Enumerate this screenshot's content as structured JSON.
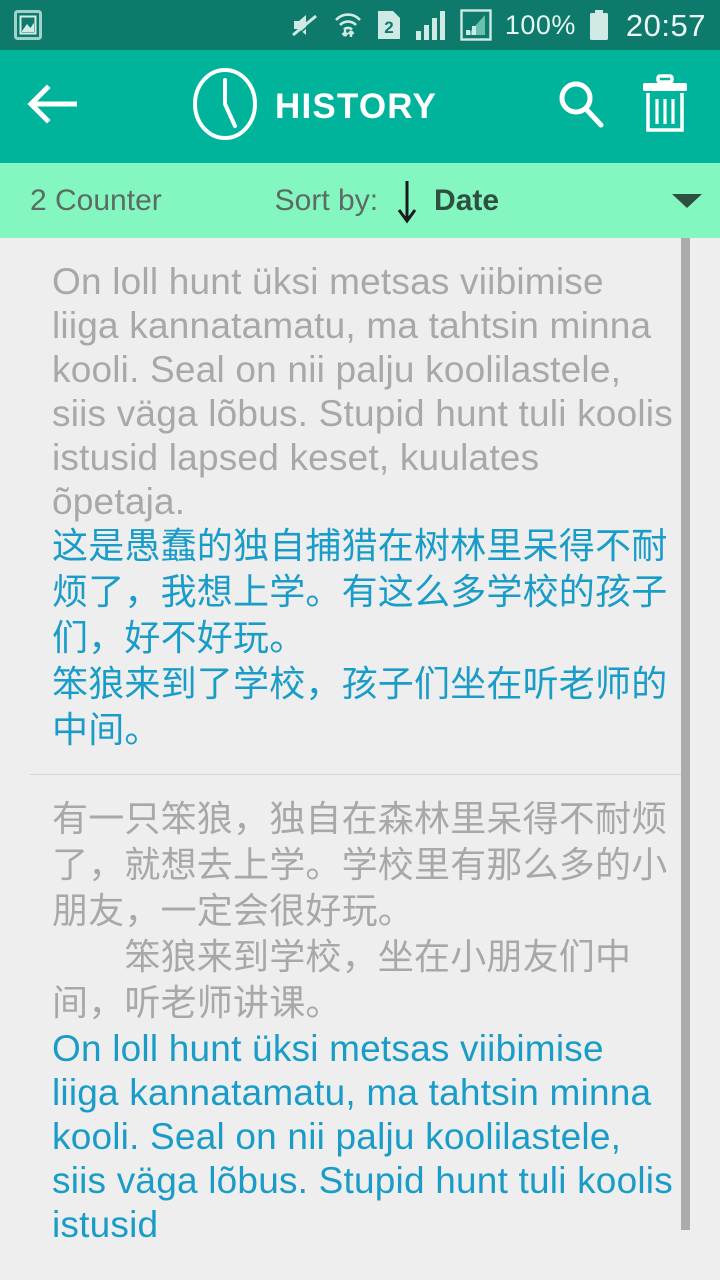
{
  "status_bar": {
    "icons": [
      "image-notification-icon",
      "mute-icon",
      "wifi-transfer-icon",
      "sim2-icon",
      "signal-bars-icon",
      "signal-box-icon"
    ],
    "battery_percent": "100%",
    "battery_icon": "battery-full-icon",
    "clock": "20:57",
    "background_color": "#0d7a6b"
  },
  "action_bar": {
    "back_icon": "arrow-left-icon",
    "clock_icon": "clock-icon",
    "title": "HISTORY",
    "search_icon": "search-icon",
    "delete_icon": "trash-icon",
    "background_color": "#00b49c",
    "text_color": "#ffffff"
  },
  "sort_bar": {
    "counter": "2 Counter",
    "sort_label": "Sort by:",
    "sort_direction_icon": "arrow-down-icon",
    "sort_value": "Date",
    "dropdown_icon": "chevron-down-icon",
    "background_color": "#84f6bf"
  },
  "history": {
    "items": [
      {
        "source_text": "On loll hunt üksi metsas viibimise liiga kannatamatu, ma tahtsin minna kooli. Seal on nii palju koolilastele, siis väga lõbus. Stupid hunt tuli koolis istusid lapsed keset, kuulates õpetaja.",
        "source_color": "#a8a8a8",
        "target_text": "这是愚蠢的独自捕猎在树林里呆得不耐烦了，我想上学。有这么多学校的孩子们，好不好玩。\n笨狼来到了学校，孩子们坐在听老师的中间。",
        "target_color": "#1a9cc8"
      },
      {
        "source_text": "有一只笨狼，独自在森林里呆得不耐烦了，就想去上学。学校里有那么多的小朋友，一定会很好玩。\n　　笨狼来到学校，坐在小朋友们中间，听老师讲课。",
        "source_color": "#a8a8a8",
        "target_text": "On loll hunt üksi metsas viibimise liiga kannatamatu, ma tahtsin minna kooli. Seal on nii palju koolilastele, siis väga lõbus. Stupid hunt tuli koolis istusid",
        "target_color": "#1a9cc8"
      }
    ]
  },
  "scrollbar": {
    "name": "vertical-scrollbar",
    "color": "#ababab"
  }
}
